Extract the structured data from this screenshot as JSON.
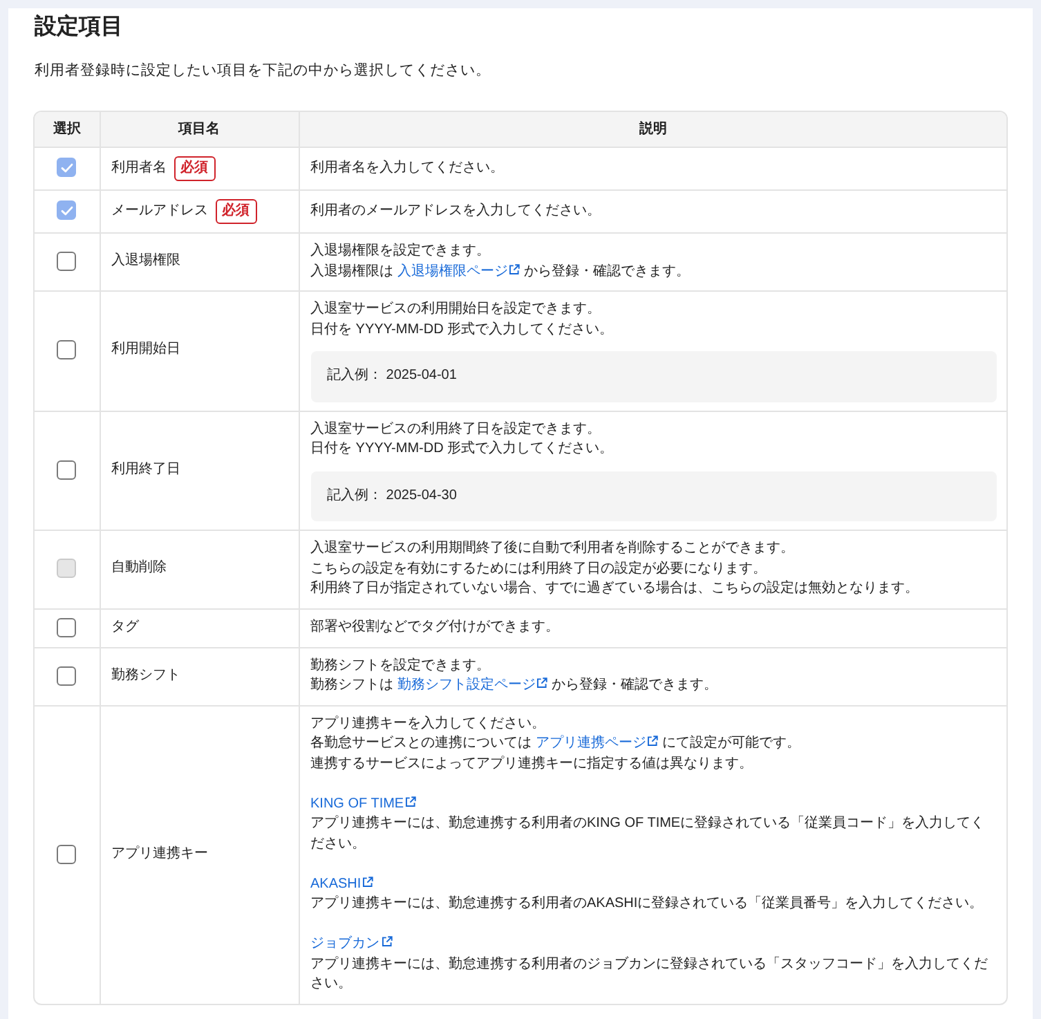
{
  "title": "設定項目",
  "subtitle": "利用者登録時に設定したい項目を下記の中から選択してください。",
  "table": {
    "columns": [
      "選択",
      "項目名",
      "説明"
    ],
    "rows": [
      {
        "name": "利用者名",
        "badge": "必須",
        "checked": true,
        "disabled": true,
        "description": [
          {
            "kind": "text",
            "text": "利用者名を入力してください。"
          }
        ]
      },
      {
        "name": "メールアドレス",
        "badge": "必須",
        "checked": true,
        "disabled": true,
        "description": [
          {
            "kind": "text",
            "text": "利用者のメールアドレスを入力してください。"
          }
        ]
      },
      {
        "name": "入退場権限",
        "checked": false,
        "disabled": false,
        "description": [
          {
            "kind": "text",
            "text": "入退場権限を設定できます。"
          },
          {
            "kind": "link_text",
            "before": "入退場権限は",
            "link": "入退場権限ページ",
            "after": "から登録・確認できます。"
          }
        ]
      },
      {
        "name": "利用開始日",
        "checked": false,
        "disabled": false,
        "description": [
          {
            "kind": "text",
            "text": "入退室サービスの利用開始日を設定できます。"
          },
          {
            "kind": "text",
            "text": "日付を YYYY-MM-DD 形式で入力してください。"
          },
          {
            "kind": "example",
            "text": "記入例： 2025-04-01"
          }
        ]
      },
      {
        "name": "利用終了日",
        "checked": false,
        "disabled": false,
        "description": [
          {
            "kind": "text",
            "text": "入退室サービスの利用終了日を設定できます。"
          },
          {
            "kind": "text",
            "text": "日付を YYYY-MM-DD 形式で入力してください。"
          },
          {
            "kind": "example",
            "text": "記入例： 2025-04-30"
          }
        ]
      },
      {
        "name": "自動削除",
        "checked": false,
        "disabled": true,
        "description": [
          {
            "kind": "text",
            "text": "入退室サービスの利用期間終了後に自動で利用者を削除することができます。"
          },
          {
            "kind": "text",
            "text": "こちらの設定を有効にするためには利用終了日の設定が必要になります。"
          },
          {
            "kind": "text",
            "text": "利用終了日が指定されていない場合、すでに過ぎている場合は、こちらの設定は無効となります。"
          }
        ]
      },
      {
        "name": "タグ",
        "checked": false,
        "disabled": false,
        "description": [
          {
            "kind": "text",
            "text": "部署や役割などでタグ付けができます。"
          }
        ]
      },
      {
        "name": "勤務シフト",
        "checked": false,
        "disabled": false,
        "description": [
          {
            "kind": "text",
            "text": "勤務シフトを設定できます。"
          },
          {
            "kind": "link_text",
            "before": "勤務シフトは",
            "link": "勤務シフト設定ページ",
            "after": "から登録・確認できます。"
          }
        ]
      },
      {
        "name": "アプリ連携キー",
        "checked": false,
        "disabled": false,
        "description": [
          {
            "kind": "text",
            "text": "アプリ連携キーを入力してください。"
          },
          {
            "kind": "link_text",
            "before": "各勤怠サービスとの連携については",
            "link": "アプリ連携ページ",
            "after": "にて設定が可能です。"
          },
          {
            "kind": "text",
            "text": "連携するサービスによってアプリ連携キーに指定する値は異なります。"
          },
          {
            "kind": "link",
            "link": "KING OF TIME"
          },
          {
            "kind": "text",
            "text": "アプリ連携キーには、勤怠連携する利用者のKING OF TIMEに登録されている「従業員コード」を入力してください。"
          },
          {
            "kind": "link",
            "link": "AKASHI"
          },
          {
            "kind": "text",
            "text": "アプリ連携キーには、勤怠連携する利用者のAKASHIに登録されている「従業員番号」を入力してください。"
          },
          {
            "kind": "link",
            "link": "ジョブカン"
          },
          {
            "kind": "text",
            "text": "アプリ連携キーには、勤怠連携する利用者のジョブカンに登録されている「スタッフコード」を入力してください。"
          }
        ]
      }
    ]
  }
}
